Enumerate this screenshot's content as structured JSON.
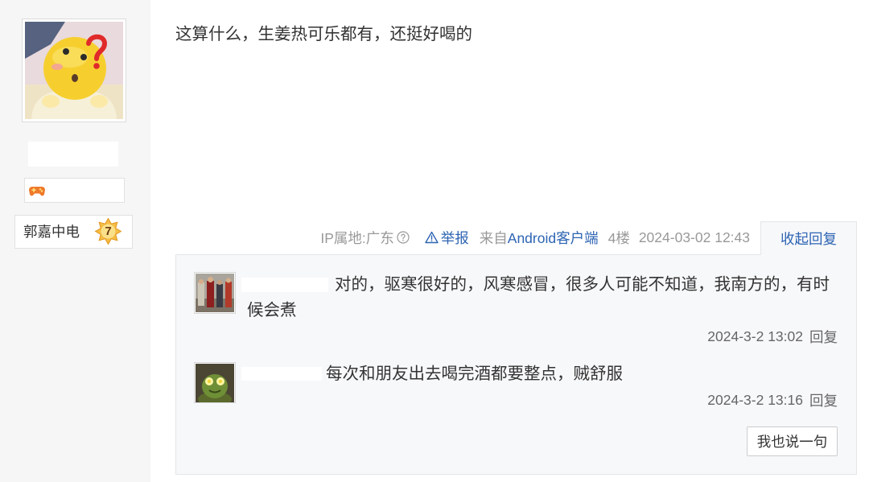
{
  "colors": {
    "text": "#333333",
    "meta": "#999999",
    "link": "#2d64b3",
    "time": "#666666",
    "panel": "#f7f8fa",
    "sidebar": "#f6f6f6"
  },
  "sidebar": {
    "avatar_icon": "emoji-question-face",
    "badge_icon": "game-controller-icon",
    "level_badge": {
      "name": "郭嘉中电",
      "level": "7",
      "icon": "level-star-icon"
    }
  },
  "post": {
    "content": "这算什么，生姜热可乐都有，还挺好喝的",
    "meta": {
      "ip_location": "IP属地:广东",
      "ip_help_icon": "help-circle-icon",
      "report_icon": "warning-icon",
      "report_label": "举报",
      "source_prefix": "来自",
      "source_client": "Android客户端",
      "floor": "4楼",
      "time": "2024-03-02 12:43"
    },
    "toggle_replies_label": "收起回复"
  },
  "replies": {
    "items": [
      {
        "content": "对的，驱寒很好的，风寒感冒，很多人可能不知道，我南方的，有时候会煮",
        "time": "2024-3-2 13:02",
        "reply_label": "回复"
      },
      {
        "content": "每次和朋友出去喝完酒都要整点，贼舒服",
        "time": "2024-3-2 13:16",
        "reply_label": "回复"
      }
    ],
    "write_reply_label": "我也说一句"
  }
}
